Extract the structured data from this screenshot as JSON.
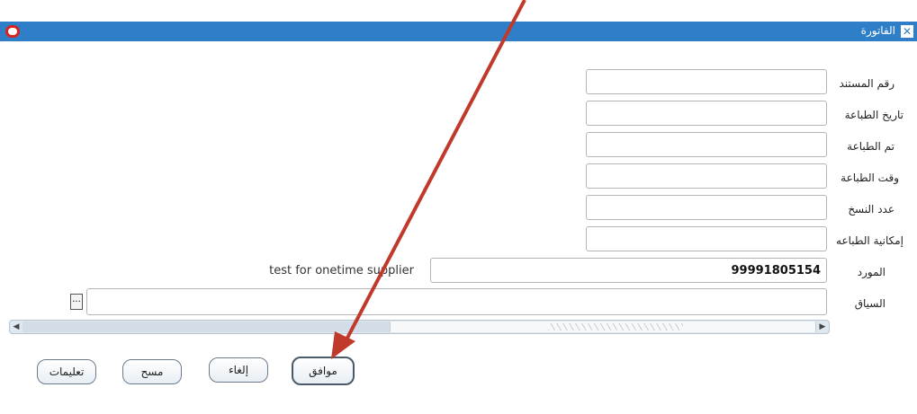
{
  "window": {
    "title": "الفاتورة",
    "close_glyph": "✕",
    "logo": "oracle-logo"
  },
  "form": {
    "fields": [
      {
        "label": "رقم المستند",
        "value": ""
      },
      {
        "label": "تاريخ الطباعة",
        "value": ""
      },
      {
        "label": "تم الطباعة",
        "value": ""
      },
      {
        "label": "وقت الطباعة",
        "value": ""
      },
      {
        "label": "عدد النسخ",
        "value": ""
      },
      {
        "label": "إمكانية الطباعه",
        "value": ""
      }
    ],
    "supplier": {
      "label": "المورد",
      "number": "99991805154",
      "name": "test for onetime supplier"
    },
    "context": {
      "label": "السياق",
      "value": "",
      "lov_label": "..."
    }
  },
  "scrollbar": {
    "left_arrow": "◀",
    "right_arrow": "▶"
  },
  "buttons": {
    "ok": "موافق",
    "cancel": "إلغاء",
    "clear": "مسح",
    "help": "تعليمات"
  },
  "annotation": {
    "arrow_color": "#c0392b"
  }
}
